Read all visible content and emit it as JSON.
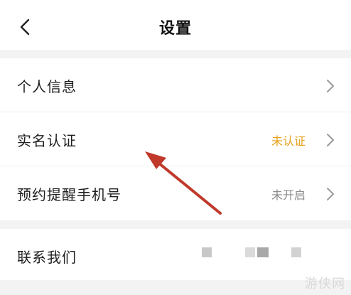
{
  "header": {
    "title": "设置",
    "back_icon": "chevron-left-icon"
  },
  "settings": {
    "items": [
      {
        "label": "个人信息",
        "value": "",
        "icon": "chevron-right-icon"
      },
      {
        "label": "实名认证",
        "value": "未认证",
        "value_color": "#e6a21b",
        "icon": "chevron-right-icon"
      },
      {
        "label": "预约提醒手机号",
        "value": "未开启",
        "value_color": "#8c8c8c",
        "icon": "chevron-right-icon"
      }
    ]
  },
  "contact": {
    "label": "联系我们"
  },
  "annotation": {
    "arrow_color": "#c0392b"
  },
  "watermark": "游侠网"
}
